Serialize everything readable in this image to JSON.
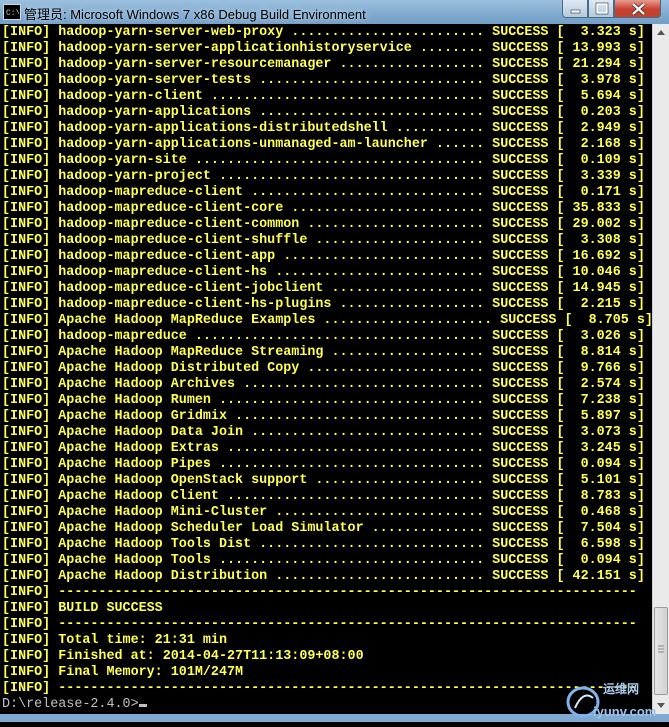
{
  "window": {
    "title": "管理员: Microsoft Windows 7 x86 Debug Build Environment"
  },
  "console": {
    "lines": [
      "[INFO] hadoop-yarn-server-web-proxy ........................ SUCCESS [  3.323 s]",
      "[INFO] hadoop-yarn-server-applicationhistoryservice ........ SUCCESS [ 13.993 s]",
      "[INFO] hadoop-yarn-server-resourcemanager .................. SUCCESS [ 21.294 s]",
      "[INFO] hadoop-yarn-server-tests ............................ SUCCESS [  3.978 s]",
      "[INFO] hadoop-yarn-client .................................. SUCCESS [  5.694 s]",
      "[INFO] hadoop-yarn-applications ............................ SUCCESS [  0.203 s]",
      "[INFO] hadoop-yarn-applications-distributedshell ........... SUCCESS [  2.949 s]",
      "[INFO] hadoop-yarn-applications-unmanaged-am-launcher ...... SUCCESS [  2.168 s]",
      "[INFO] hadoop-yarn-site .................................... SUCCESS [  0.109 s]",
      "[INFO] hadoop-yarn-project ................................. SUCCESS [  3.339 s]",
      "[INFO] hadoop-mapreduce-client ............................. SUCCESS [  0.171 s]",
      "[INFO] hadoop-mapreduce-client-core ........................ SUCCESS [ 35.833 s]",
      "[INFO] hadoop-mapreduce-client-common ...................... SUCCESS [ 29.002 s]",
      "[INFO] hadoop-mapreduce-client-shuffle ..................... SUCCESS [  3.308 s]",
      "[INFO] hadoop-mapreduce-client-app ......................... SUCCESS [ 16.692 s]",
      "[INFO] hadoop-mapreduce-client-hs .......................... SUCCESS [ 10.046 s]",
      "[INFO] hadoop-mapreduce-client-jobclient ................... SUCCESS [ 14.945 s]",
      "[INFO] hadoop-mapreduce-client-hs-plugins .................. SUCCESS [  2.215 s]",
      "[INFO] Apache Hadoop MapReduce Examples ..................... SUCCESS [  8.705 s]",
      "[INFO] hadoop-mapreduce .................................... SUCCESS [  3.026 s]",
      "[INFO] Apache Hadoop MapReduce Streaming ................... SUCCESS [  8.814 s]",
      "[INFO] Apache Hadoop Distributed Copy ...................... SUCCESS [  9.766 s]",
      "[INFO] Apache Hadoop Archives .............................. SUCCESS [  2.574 s]",
      "[INFO] Apache Hadoop Rumen ................................. SUCCESS [  7.238 s]",
      "[INFO] Apache Hadoop Gridmix ............................... SUCCESS [  5.897 s]",
      "[INFO] Apache Hadoop Data Join ............................. SUCCESS [  3.073 s]",
      "[INFO] Apache Hadoop Extras ................................ SUCCESS [  3.245 s]",
      "[INFO] Apache Hadoop Pipes ................................. SUCCESS [  0.094 s]",
      "[INFO] Apache Hadoop OpenStack support ..................... SUCCESS [  5.101 s]",
      "[INFO] Apache Hadoop Client ................................ SUCCESS [  8.783 s]",
      "[INFO] Apache Hadoop Mini-Cluster .......................... SUCCESS [  0.468 s]",
      "[INFO] Apache Hadoop Scheduler Load Simulator .............. SUCCESS [  7.504 s]",
      "[INFO] Apache Hadoop Tools Dist ............................ SUCCESS [  6.598 s]",
      "[INFO] Apache Hadoop Tools ................................. SUCCESS [  0.094 s]",
      "[INFO] Apache Hadoop Distribution .......................... SUCCESS [ 42.151 s]",
      "[INFO] ------------------------------------------------------------------------",
      "[INFO] BUILD SUCCESS",
      "[INFO] ------------------------------------------------------------------------",
      "[INFO] Total time: 21:31 min",
      "[INFO] Finished at: 2014-04-27T11:13:09+08:00",
      "[INFO] Final Memory: 101M/247M",
      "[INFO] ------------------------------------------------------------------------"
    ],
    "prompt": "D:\\release-2.4.0>"
  },
  "watermark": {
    "line1": "运维网",
    "line2": "iyunv.com"
  },
  "colors": {
    "console_bg": "#000000",
    "console_text": "#ffff55",
    "prompt_text": "#c0c0c0",
    "titlebar": "#7fa9cf",
    "close_button": "#c7402f"
  },
  "icons": [
    "cmd-icon",
    "minimize-icon",
    "maximize-icon",
    "close-icon",
    "scroll-up-icon",
    "scroll-down-icon"
  ]
}
